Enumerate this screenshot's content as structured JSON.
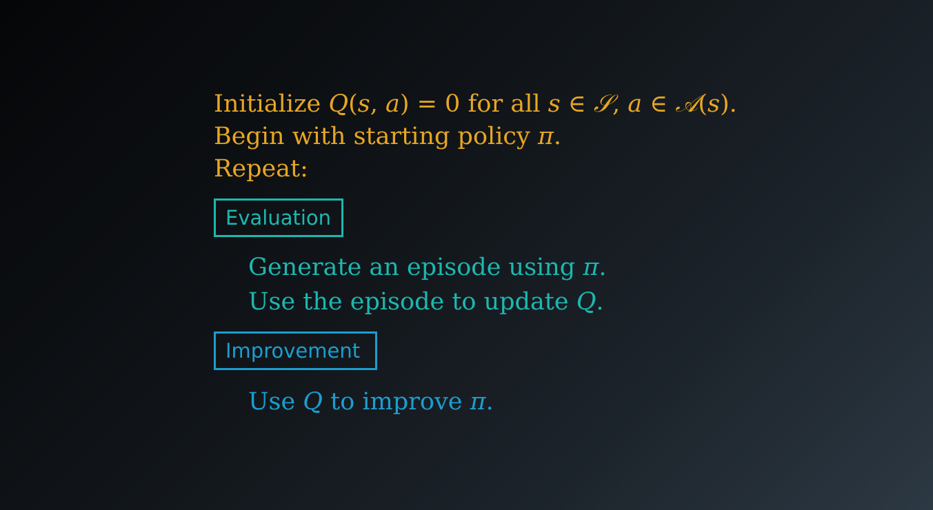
{
  "intro": {
    "line1": {
      "t1": "Initialize ",
      "m1": "Q",
      "t2": "(",
      "m2": "s",
      "t3": ", ",
      "m3": "a",
      "t4": ") = 0 for all ",
      "m4": "s",
      "t5": " ∈ ",
      "m5": "𝒮",
      "t6": ", ",
      "m6": "a",
      "t7": " ∈ ",
      "m7": "𝒜",
      "t8": "(",
      "m8": "s",
      "t9": ")."
    },
    "line2": {
      "t1": "Begin with starting policy ",
      "m1": "π",
      "t2": "."
    },
    "line3": "Repeat:"
  },
  "evaluation": {
    "label": "Evaluation",
    "step1": {
      "t1": "Generate an episode using ",
      "m1": "π",
      "t2": "."
    },
    "step2": {
      "t1": "Use the episode to update ",
      "m1": "Q",
      "t2": "."
    }
  },
  "improvement": {
    "label": "Improvement",
    "step1": {
      "t1": "Use ",
      "m1": "Q",
      "t2": " to improve ",
      "m2": "π",
      "t3": "."
    }
  },
  "colors": {
    "intro": "#e8a623",
    "evaluation": "#1cb8b0",
    "improvement": "#1b9ed0"
  }
}
